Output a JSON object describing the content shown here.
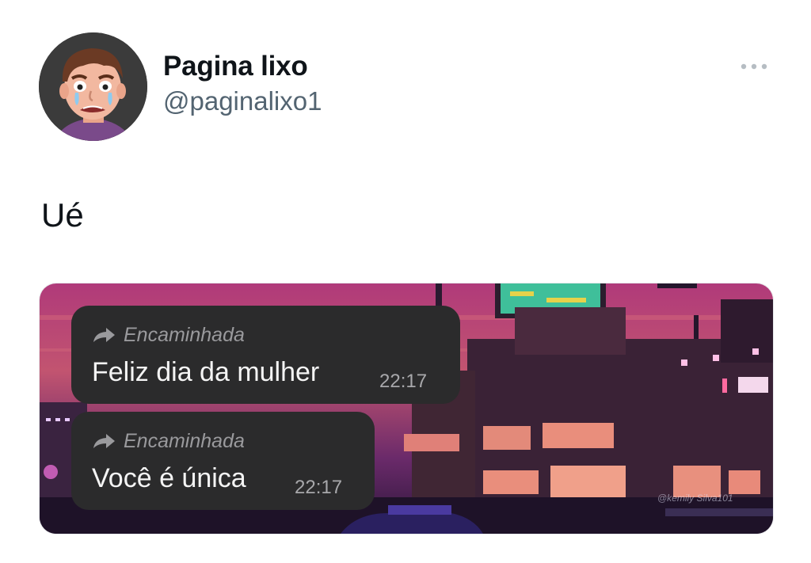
{
  "author": {
    "display_name": "Pagina lixo",
    "handle": "@paginalixo1",
    "avatar_icon": "crying-cartoon-face-avatar"
  },
  "more_icon": "more-horizontal-icon",
  "tweet_text": "Ué",
  "media": {
    "messages": [
      {
        "forward_icon": "forward-arrow-icon",
        "forward_label": "Encaminhada",
        "text": "Feliz dia da mulher",
        "time": "22:17"
      },
      {
        "forward_icon": "forward-arrow-icon",
        "forward_label": "Encaminhada",
        "text": "Você é única",
        "time": "22:17"
      }
    ],
    "watermark": "@kemily Silva101"
  },
  "colors": {
    "bubble": "#2b2b2c",
    "name": "#0f1419",
    "handle": "#536471"
  }
}
